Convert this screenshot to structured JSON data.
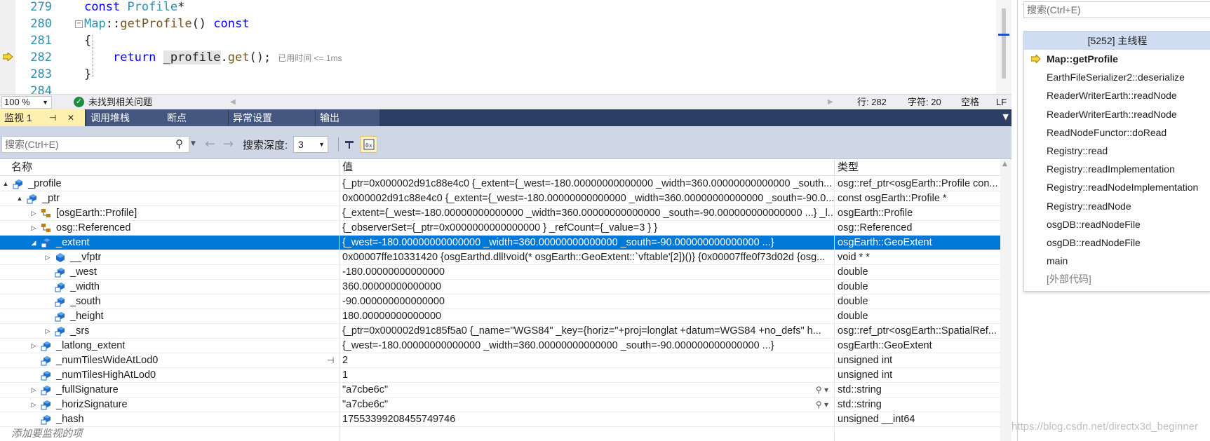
{
  "editor": {
    "lines": [
      {
        "num": "279",
        "parts": [
          {
            "t": "const ",
            "c": "kw"
          },
          {
            "t": "Profile",
            "c": "ty"
          },
          {
            "t": "*",
            "c": ""
          }
        ]
      },
      {
        "num": "280",
        "parts": [
          {
            "t": "Map",
            "c": "ty"
          },
          {
            "t": "::",
            "c": ""
          },
          {
            "t": "getProfile",
            "c": "fn"
          },
          {
            "t": "() ",
            "c": ""
          },
          {
            "t": "const",
            "c": "kw"
          }
        ]
      },
      {
        "num": "281",
        "parts": [
          {
            "t": "{",
            "c": ""
          }
        ]
      },
      {
        "num": "282",
        "parts": [
          {
            "t": "    ",
            "c": ""
          },
          {
            "t": "return ",
            "c": "kw"
          },
          {
            "t": "_profile",
            "c": "hl"
          },
          {
            "t": ".",
            "c": ""
          },
          {
            "t": "get",
            "c": "fn"
          },
          {
            "t": "();",
            "c": ""
          }
        ]
      },
      {
        "num": "283",
        "parts": [
          {
            "t": "}",
            "c": ""
          }
        ]
      },
      {
        "num": "284",
        "parts": []
      }
    ],
    "elapsed_hint": "已用时间 <= 1ms"
  },
  "status": {
    "zoom": "100 %",
    "issues_text": "未找到相关问题",
    "line": "行: 282",
    "char": "字符: 20",
    "spacing": "空格",
    "eol": "LF"
  },
  "tabs": [
    {
      "label": "监视 1",
      "active": true
    },
    {
      "label": "调用堆栈",
      "active": false
    },
    {
      "label": "断点",
      "active": false
    },
    {
      "label": "异常设置",
      "active": false
    },
    {
      "label": "输出",
      "active": false
    }
  ],
  "watch_toolbar": {
    "search_placeholder": "搜索(Ctrl+E)",
    "depth_label": "搜索深度:",
    "depth_value": "3"
  },
  "watch": {
    "columns": {
      "name": "名称",
      "value": "值",
      "type": "类型"
    },
    "rows": [
      {
        "indent": 1,
        "exp": "▲",
        "icon": "field",
        "name": "_profile",
        "value": "{_ptr=0x000002d91c88e4c0 {_extent={_west=-180.00000000000000 _width=360.00000000000000 _south...",
        "type": "osg::ref_ptr<osgEarth::Profile con..."
      },
      {
        "indent": 2,
        "exp": "▲",
        "icon": "field",
        "name": "_ptr",
        "value": "0x000002d91c88e4c0 {_extent={_west=-180.00000000000000 _width=360.00000000000000 _south=-90.0...",
        "type": "const osgEarth::Profile *"
      },
      {
        "indent": 3,
        "exp": "▷",
        "icon": "base",
        "name": "[osgEarth::Profile]",
        "value": "{_extent={_west=-180.00000000000000 _width=360.00000000000000 _south=-90.000000000000000 ...} _l...",
        "type": "osgEarth::Profile"
      },
      {
        "indent": 3,
        "exp": "▷",
        "icon": "base",
        "name": "osg::Referenced",
        "value": "{_observerSet={_ptr=0x0000000000000000 } _refCount={_value=3 } }",
        "type": "osg::Referenced"
      },
      {
        "indent": 3,
        "exp": "◢",
        "icon": "field",
        "name": "_extent",
        "value": "{_west=-180.00000000000000 _width=360.00000000000000 _south=-90.000000000000000 ...}",
        "type": "osgEarth::GeoExtent",
        "selected": true
      },
      {
        "indent": 4,
        "exp": "▷",
        "icon": "vptr",
        "name": "__vfptr",
        "value": "0x00007ffe10331420 {osgEarthd.dll!void(* osgEarth::GeoExtent::`vftable'[2])()} {0x00007ffe0f73d02d {osg...",
        "type": "void * *"
      },
      {
        "indent": 4,
        "exp": "",
        "icon": "field",
        "name": "_west",
        "value": "-180.00000000000000",
        "type": "double"
      },
      {
        "indent": 4,
        "exp": "",
        "icon": "field",
        "name": "_width",
        "value": "360.00000000000000",
        "type": "double"
      },
      {
        "indent": 4,
        "exp": "",
        "icon": "field",
        "name": "_south",
        "value": "-90.000000000000000",
        "type": "double"
      },
      {
        "indent": 4,
        "exp": "",
        "icon": "field",
        "name": "_height",
        "value": "180.00000000000000",
        "type": "double"
      },
      {
        "indent": 4,
        "exp": "▷",
        "icon": "field",
        "name": "_srs",
        "value": "{_ptr=0x000002d91c85f5a0 {_name=\"WGS84\" _key={horiz=\"+proj=longlat +datum=WGS84 +no_defs\" h...",
        "type": "osg::ref_ptr<osgEarth::SpatialRef..."
      },
      {
        "indent": 3,
        "exp": "▷",
        "icon": "field",
        "name": "_latlong_extent",
        "value": "{_west=-180.00000000000000 _width=360.00000000000000 _south=-90.000000000000000 ...}",
        "type": "osgEarth::GeoExtent"
      },
      {
        "indent": 3,
        "exp": "",
        "icon": "field",
        "name": "_numTilesWideAtLod0",
        "value": "2",
        "type": "unsigned int",
        "pin": true
      },
      {
        "indent": 3,
        "exp": "",
        "icon": "field",
        "name": "_numTilesHighAtLod0",
        "value": "1",
        "type": "unsigned int"
      },
      {
        "indent": 3,
        "exp": "▷",
        "icon": "field",
        "name": "_fullSignature",
        "value": "\"a7cbe6c\"",
        "type": "std::string",
        "mag": true
      },
      {
        "indent": 3,
        "exp": "▷",
        "icon": "field",
        "name": "_horizSignature",
        "value": "\"a7cbe6c\"",
        "type": "std::string",
        "mag": true
      },
      {
        "indent": 3,
        "exp": "",
        "icon": "field",
        "name": "_hash",
        "value": "17553399208455749746",
        "type": "unsigned __int64"
      },
      {
        "indent": 0,
        "exp": "",
        "icon": "",
        "name": "添加要监视的项",
        "value": "",
        "type": "",
        "add": true
      }
    ]
  },
  "callstack": {
    "search_placeholder": "搜索(Ctrl+E)",
    "thread": "[5252] 主线程",
    "frames": [
      {
        "name": "Map::getProfile",
        "current": true
      },
      {
        "name": "EarthFileSerializer2::deserialize"
      },
      {
        "name": "ReaderWriterEarth::readNode"
      },
      {
        "name": "ReaderWriterEarth::readNode"
      },
      {
        "name": "ReadNodeFunctor::doRead"
      },
      {
        "name": "Registry::read"
      },
      {
        "name": "Registry::readImplementation"
      },
      {
        "name": "Registry::readNodeImplementation"
      },
      {
        "name": "Registry::readNode"
      },
      {
        "name": "osgDB::readNodeFile"
      },
      {
        "name": "osgDB::readNodeFile"
      },
      {
        "name": "main"
      },
      {
        "name": "[外部代码]",
        "external": true
      }
    ]
  },
  "watermark": "https://blog.csdn.net/directx3d_beginner",
  "colors": {
    "selection": "#0078d7",
    "tab_active": "#fff0b0",
    "tab_bg": "#2d3e64",
    "keyword": "#0000ff",
    "type": "#2b91af"
  }
}
